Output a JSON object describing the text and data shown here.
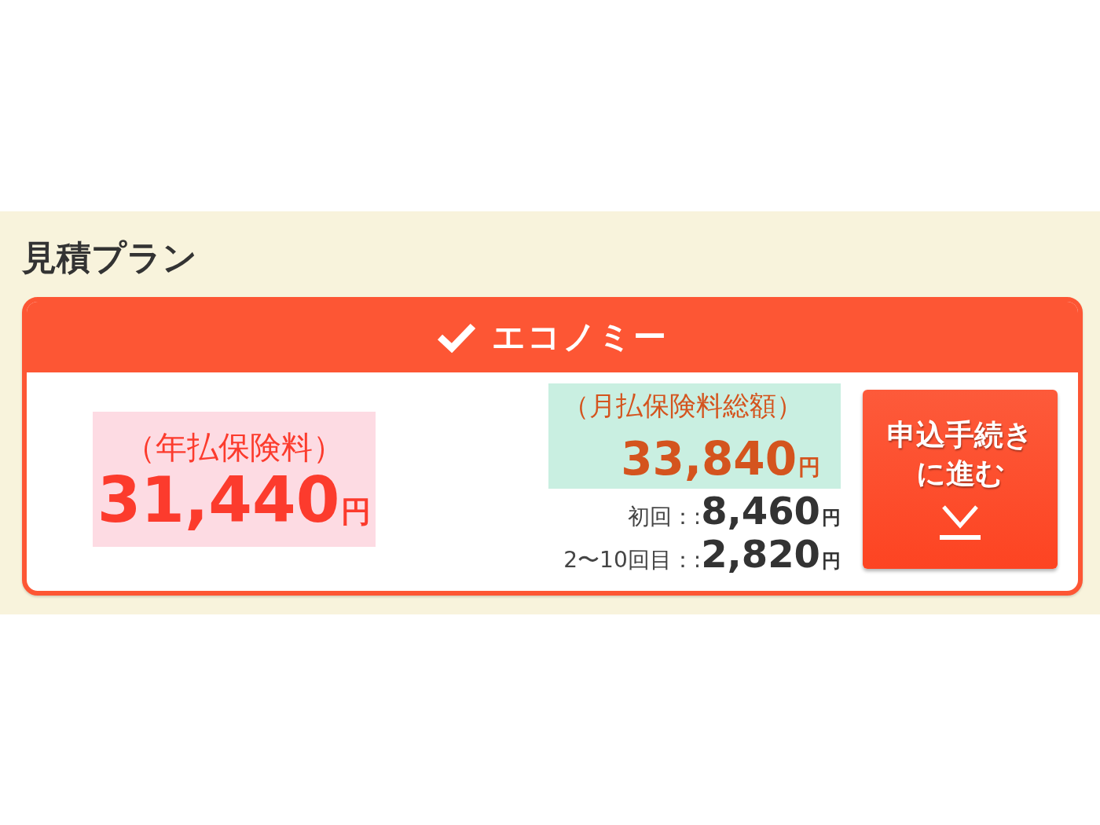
{
  "section_title": "見積プラン",
  "plan": {
    "name": "エコノミー",
    "annual": {
      "label": "（年払保険料）",
      "amount": "31,440",
      "unit": "円"
    },
    "monthly": {
      "label": "（月払保険料総額）",
      "amount": "33,840",
      "unit": "円"
    },
    "installments": [
      {
        "label": "初回：:",
        "amount": "8,460",
        "unit": "円"
      },
      {
        "label": "2〜10回目：:",
        "amount": "2,820",
        "unit": "円"
      }
    ],
    "apply_button": "申込手続きに進む"
  }
}
